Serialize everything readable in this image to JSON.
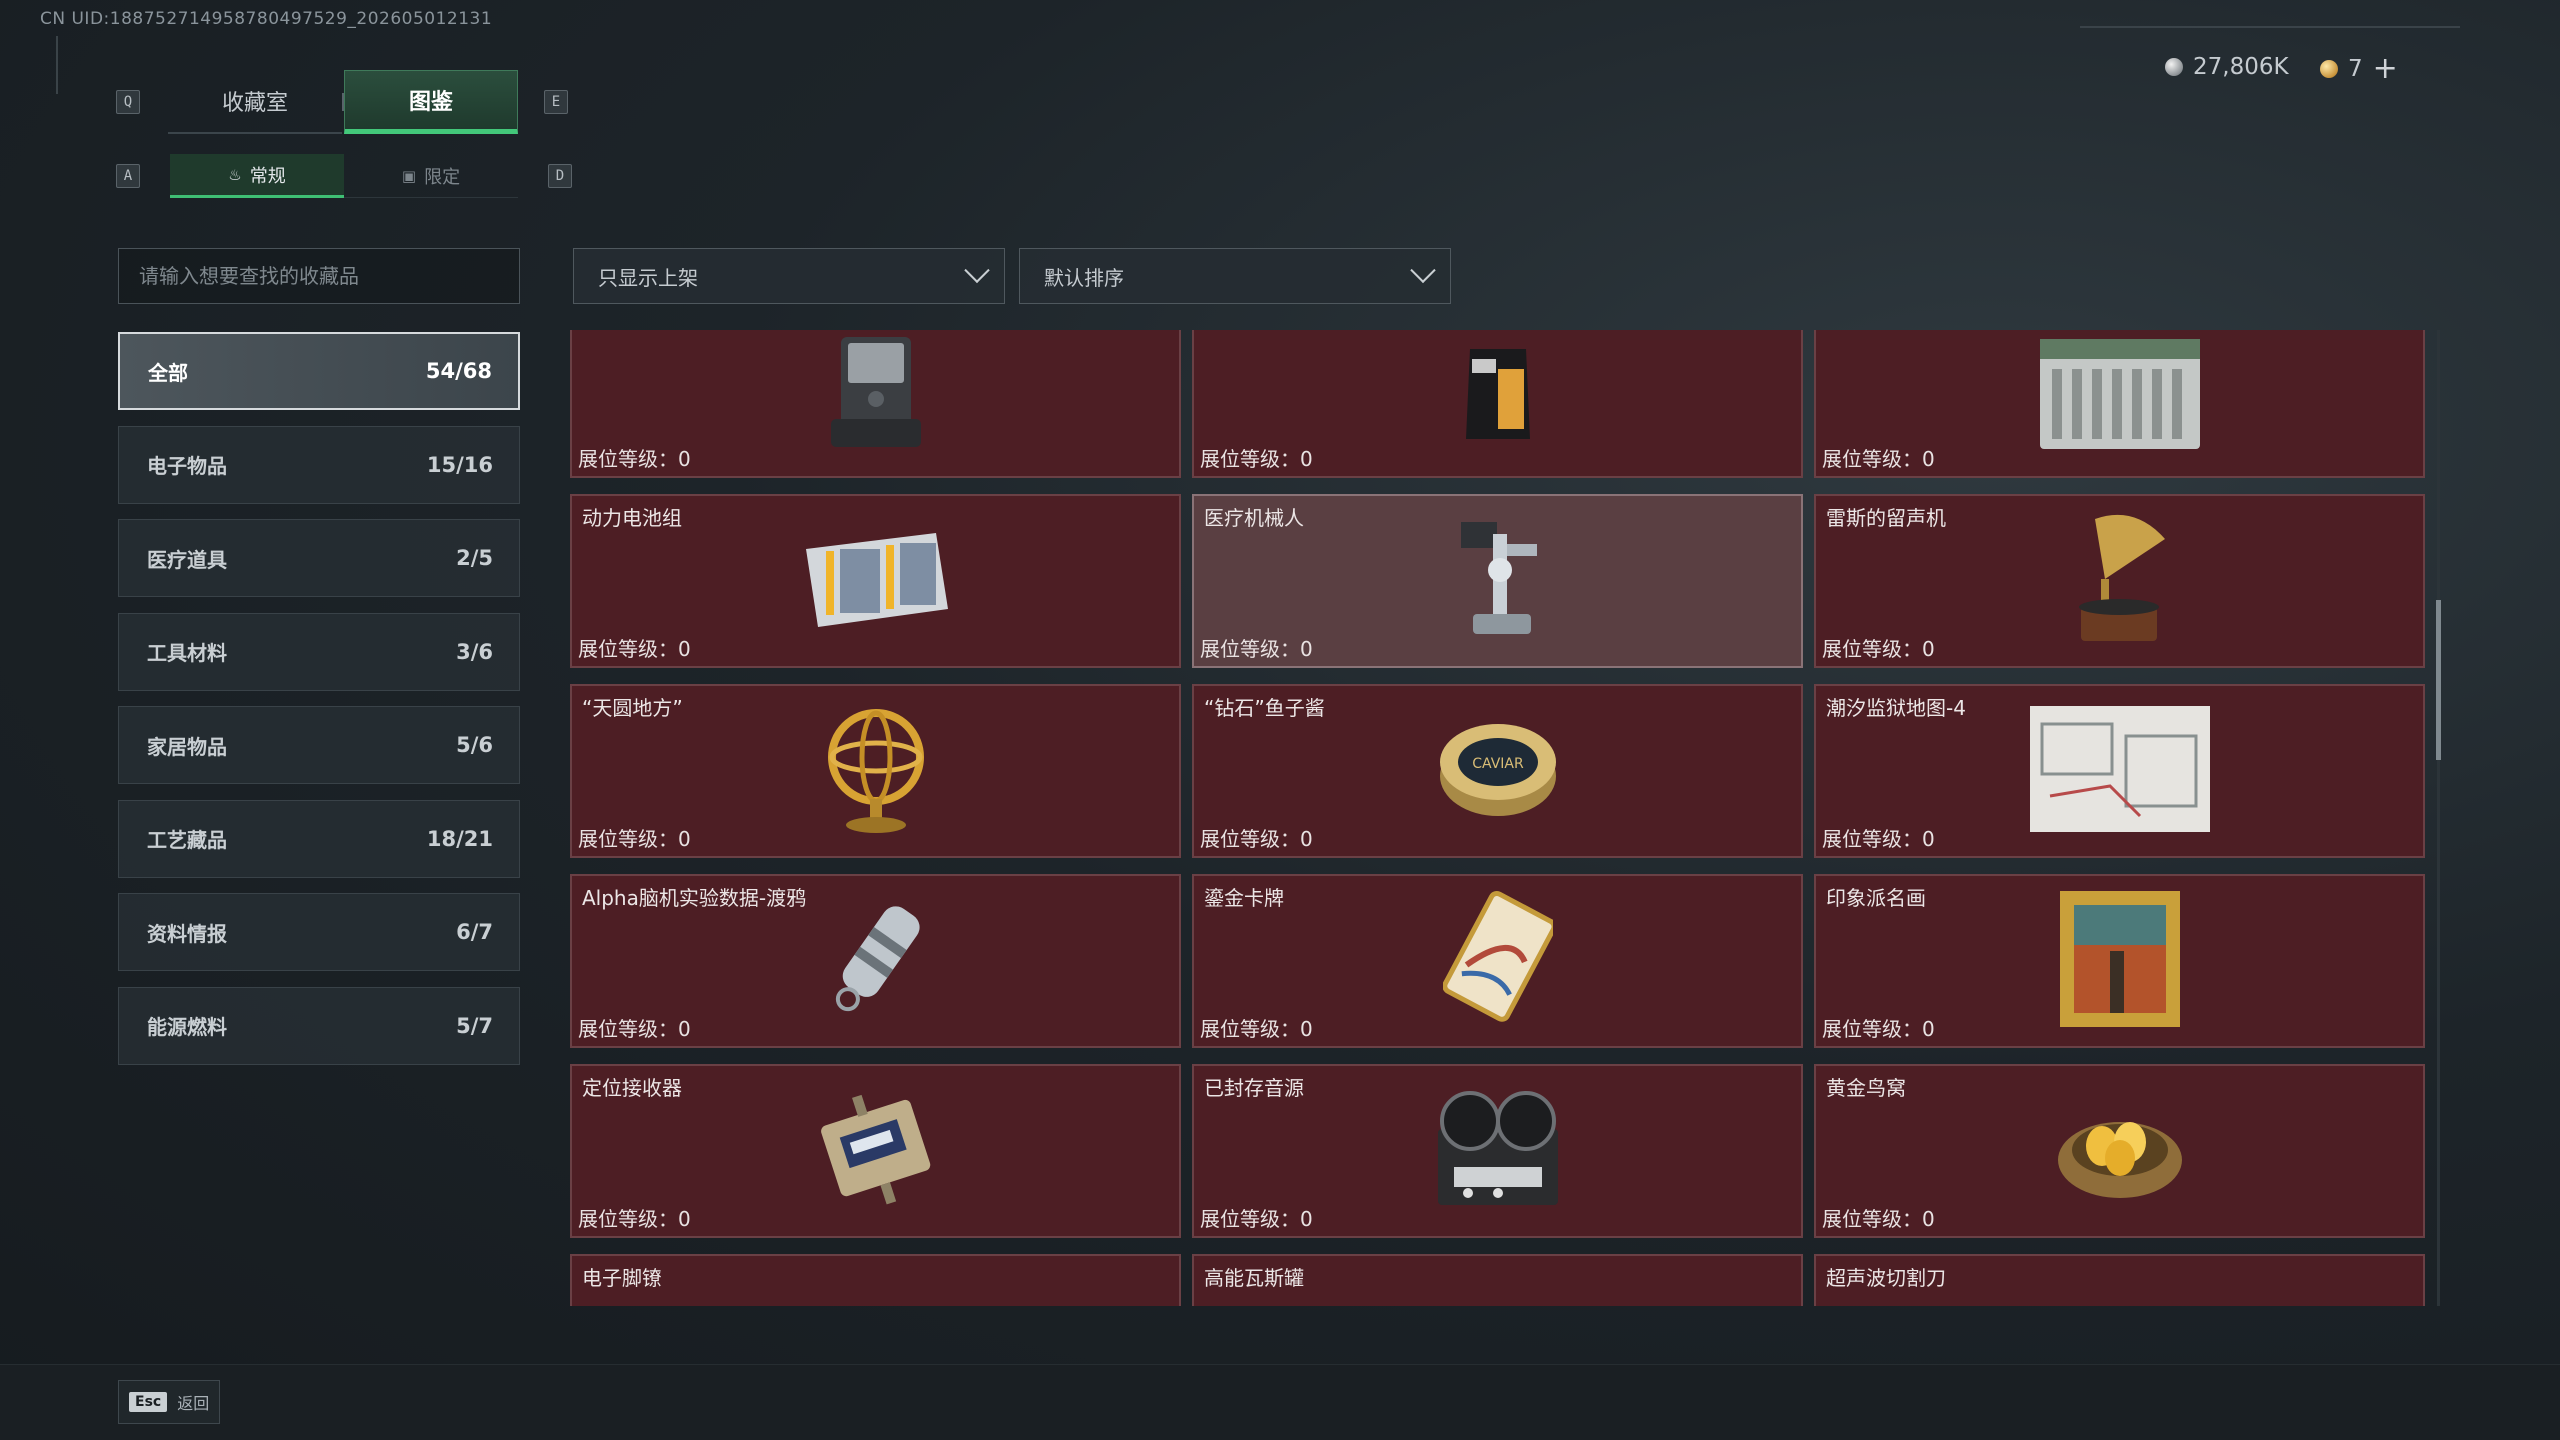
{
  "uid_text": "CN UID:18875271495878049​7529_202605012131",
  "currency": {
    "silver": "27,806K",
    "gold": "7",
    "plus": "+"
  },
  "keys": {
    "prev_tab": "Q",
    "next_tab": "E",
    "prev_sub": "A",
    "next_sub": "D"
  },
  "tabs": [
    {
      "label": "收藏室",
      "active": false
    },
    {
      "label": "图鉴",
      "active": true
    }
  ],
  "subtabs": [
    {
      "label": "常规",
      "icon": "flame-icon",
      "glyph": "♨",
      "active": true
    },
    {
      "label": "限定",
      "icon": "image-icon",
      "glyph": "▣",
      "active": false
    }
  ],
  "search": {
    "placeholder": "请输入想要查找的收藏品"
  },
  "categories": [
    {
      "label": "全部",
      "count": "54/68",
      "active": true
    },
    {
      "label": "电子物品",
      "count": "15/16"
    },
    {
      "label": "医疗道具",
      "count": "2/5"
    },
    {
      "label": "工具材料",
      "count": "3/6"
    },
    {
      "label": "家居物品",
      "count": "5/6"
    },
    {
      "label": "工艺藏品",
      "count": "18/21"
    },
    {
      "label": "资料情报",
      "count": "6/7"
    },
    {
      "label": "能源燃料",
      "count": "5/7"
    }
  ],
  "filters": {
    "display": "只显示上架",
    "sort": "默认排序"
  },
  "level_label": "展位等级：0",
  "items": [
    {
      "name": "",
      "icon": "robot-vacuum-icon",
      "level": "展位等级：0"
    },
    {
      "name": "",
      "icon": "coffee-bag-icon",
      "level": "展位等级：0"
    },
    {
      "name": "",
      "icon": "server-unit-icon",
      "level": "展位等级：0"
    },
    {
      "name": "动力电池组",
      "icon": "battery-pack-icon",
      "level": "展位等级：0"
    },
    {
      "name": "医疗机械人",
      "icon": "medical-robot-icon",
      "level": "展位等级：0",
      "highlight": true
    },
    {
      "name": "雷斯的留声机",
      "icon": "gramophone-icon",
      "level": "展位等级：0"
    },
    {
      "name": "“天圆地方”",
      "icon": "armillary-sphere-icon",
      "level": "展位等级：0"
    },
    {
      "name": "“钻石”鱼子酱",
      "icon": "caviar-tin-icon",
      "level": "展位等级：0"
    },
    {
      "name": "潮汐监狱地图-4",
      "icon": "map-icon",
      "level": "展位等级：0"
    },
    {
      "name": "Alpha脑机实验数据-渡鸦",
      "icon": "data-capsule-icon",
      "level": "展位等级：0"
    },
    {
      "name": "鎏金卡牌",
      "icon": "gilded-card-icon",
      "level": "展位等级：0"
    },
    {
      "name": "印象派名画",
      "icon": "painting-icon",
      "level": "展位等级：0"
    },
    {
      "name": "定位接收器",
      "icon": "receiver-icon",
      "level": "展位等级：0"
    },
    {
      "name": "已封存音源",
      "icon": "tape-recorder-icon",
      "level": "展位等级：0"
    },
    {
      "name": "黄金鸟窝",
      "icon": "golden-nest-icon",
      "level": "展位等级：0"
    },
    {
      "name": "电子脚镣",
      "icon": "ankle-monitor-icon",
      "level": ""
    },
    {
      "name": "高能瓦斯罐",
      "icon": "gas-canister-icon",
      "level": ""
    },
    {
      "name": "超声波切割刀",
      "icon": "ultrasonic-cutter-icon",
      "level": ""
    }
  ],
  "footer": {
    "esc_key": "Esc",
    "esc_label": "返回"
  }
}
